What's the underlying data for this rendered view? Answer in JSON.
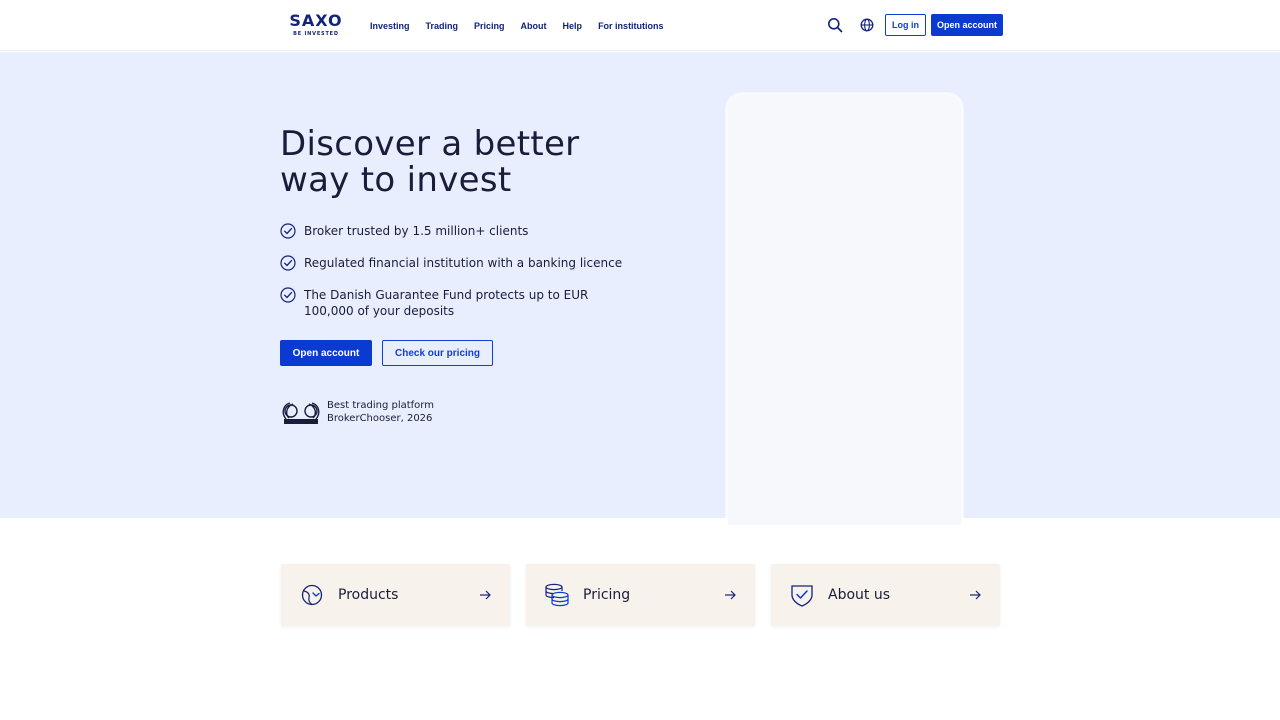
{
  "header": {
    "logo": {
      "brand": "SAXO",
      "tagline": "BE INVESTED"
    },
    "nav": [
      {
        "label": "Investing"
      },
      {
        "label": "Trading"
      },
      {
        "label": "Pricing"
      },
      {
        "label": "About"
      },
      {
        "label": "Help"
      },
      {
        "label": "For institutions"
      }
    ],
    "icons": {
      "search": "search-icon",
      "language": "globe-icon"
    },
    "login_label": "Log in",
    "open_account_label": "Open account"
  },
  "hero": {
    "title_line1": "Discover a better",
    "title_line2": "way to invest",
    "checklist": [
      "Broker trusted by 1.5 million+ clients",
      "Regulated financial institution with a banking licence",
      "The Danish Guarantee Fund protects up to EUR 100,000 of your deposits"
    ],
    "primary_cta": "Open account",
    "secondary_cta": "Check our pricing",
    "award": {
      "line1": "Best trading platform",
      "line2": "BrokerChooser, 2026"
    }
  },
  "cards": [
    {
      "label": "Products",
      "icon": "globe-chart-icon"
    },
    {
      "label": "Pricing",
      "icon": "coins-icon"
    },
    {
      "label": "About us",
      "icon": "shield-check-icon"
    }
  ],
  "colors": {
    "brand_navy": "#12247a",
    "accent_blue": "#0b3ad0",
    "hero_bg": "#e8eefd",
    "card_bg": "#f7f2ec"
  }
}
